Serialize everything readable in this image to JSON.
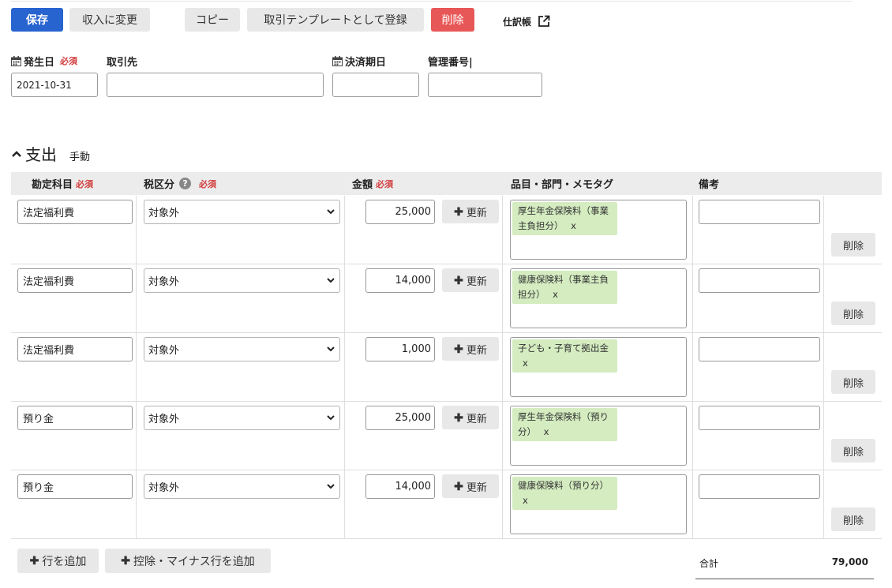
{
  "toolbar": {
    "save": "保存",
    "change_to_income": "収入に変更",
    "copy": "コピー",
    "register_template": "取引テンプレートとして登録",
    "delete": "削除",
    "journal_link": "仕訳帳"
  },
  "header_form": {
    "date_label": "発生日",
    "required": "必須",
    "date_value": "2021-10-31",
    "partner_label": "取引先",
    "partner_value": "",
    "due_label": "決済期日",
    "due_value": "",
    "mgmt_label": "管理番号|",
    "mgmt_value": ""
  },
  "section": {
    "title": "支出",
    "mode": "手動"
  },
  "table": {
    "headers": {
      "account": "勘定科目",
      "tax": "税区分",
      "amount": "金額",
      "tags": "品目・部門・メモタグ",
      "memo": "備考",
      "required": "必須"
    },
    "update_label": "更新",
    "delete_label": "削除",
    "tag_remove": "x",
    "rows": [
      {
        "account": "法定福利費",
        "tax": "対象外",
        "amount": "25,000",
        "tag_line1": "厚生年金保険料（事業",
        "tag_line2": "主負担分）",
        "memo": ""
      },
      {
        "account": "法定福利費",
        "tax": "対象外",
        "amount": "14,000",
        "tag_line1": "健康保険料（事業主負",
        "tag_line2": "担分）",
        "memo": ""
      },
      {
        "account": "法定福利費",
        "tax": "対象外",
        "amount": "1,000",
        "tag_line1": "子ども・子育て拠出金",
        "tag_line2": "",
        "memo": ""
      },
      {
        "account": "預り金",
        "tax": "対象外",
        "amount": "25,000",
        "tag_line1": "厚生年金保険料（預り",
        "tag_line2": "分）",
        "memo": ""
      },
      {
        "account": "預り金",
        "tax": "対象外",
        "amount": "14,000",
        "tag_line1": "健康保険料（預り分）",
        "tag_line2": "",
        "memo": ""
      }
    ]
  },
  "footer": {
    "add_row": "行を追加",
    "add_deduction_row": "控除・マイナス行を追加",
    "total_label": "合計",
    "total_value": "79,000"
  },
  "colors": {
    "primary": "#2864d0",
    "danger": "#e85757",
    "tag_bg": "#d4ecc0",
    "required_text": "#d23c3c"
  }
}
